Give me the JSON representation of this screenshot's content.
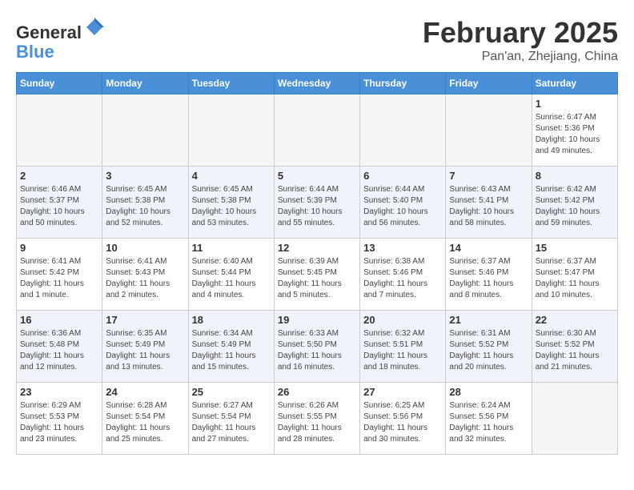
{
  "header": {
    "logo_general": "General",
    "logo_blue": "Blue",
    "month_title": "February 2025",
    "location": "Pan'an, Zhejiang, China"
  },
  "days_of_week": [
    "Sunday",
    "Monday",
    "Tuesday",
    "Wednesday",
    "Thursday",
    "Friday",
    "Saturday"
  ],
  "weeks": [
    [
      {
        "day": "",
        "info": ""
      },
      {
        "day": "",
        "info": ""
      },
      {
        "day": "",
        "info": ""
      },
      {
        "day": "",
        "info": ""
      },
      {
        "day": "",
        "info": ""
      },
      {
        "day": "",
        "info": ""
      },
      {
        "day": "1",
        "info": "Sunrise: 6:47 AM\nSunset: 5:36 PM\nDaylight: 10 hours\nand 49 minutes."
      }
    ],
    [
      {
        "day": "2",
        "info": "Sunrise: 6:46 AM\nSunset: 5:37 PM\nDaylight: 10 hours\nand 50 minutes."
      },
      {
        "day": "3",
        "info": "Sunrise: 6:45 AM\nSunset: 5:38 PM\nDaylight: 10 hours\nand 52 minutes."
      },
      {
        "day": "4",
        "info": "Sunrise: 6:45 AM\nSunset: 5:38 PM\nDaylight: 10 hours\nand 53 minutes."
      },
      {
        "day": "5",
        "info": "Sunrise: 6:44 AM\nSunset: 5:39 PM\nDaylight: 10 hours\nand 55 minutes."
      },
      {
        "day": "6",
        "info": "Sunrise: 6:44 AM\nSunset: 5:40 PM\nDaylight: 10 hours\nand 56 minutes."
      },
      {
        "day": "7",
        "info": "Sunrise: 6:43 AM\nSunset: 5:41 PM\nDaylight: 10 hours\nand 58 minutes."
      },
      {
        "day": "8",
        "info": "Sunrise: 6:42 AM\nSunset: 5:42 PM\nDaylight: 10 hours\nand 59 minutes."
      }
    ],
    [
      {
        "day": "9",
        "info": "Sunrise: 6:41 AM\nSunset: 5:42 PM\nDaylight: 11 hours\nand 1 minute."
      },
      {
        "day": "10",
        "info": "Sunrise: 6:41 AM\nSunset: 5:43 PM\nDaylight: 11 hours\nand 2 minutes."
      },
      {
        "day": "11",
        "info": "Sunrise: 6:40 AM\nSunset: 5:44 PM\nDaylight: 11 hours\nand 4 minutes."
      },
      {
        "day": "12",
        "info": "Sunrise: 6:39 AM\nSunset: 5:45 PM\nDaylight: 11 hours\nand 5 minutes."
      },
      {
        "day": "13",
        "info": "Sunrise: 6:38 AM\nSunset: 5:46 PM\nDaylight: 11 hours\nand 7 minutes."
      },
      {
        "day": "14",
        "info": "Sunrise: 6:37 AM\nSunset: 5:46 PM\nDaylight: 11 hours\nand 8 minutes."
      },
      {
        "day": "15",
        "info": "Sunrise: 6:37 AM\nSunset: 5:47 PM\nDaylight: 11 hours\nand 10 minutes."
      }
    ],
    [
      {
        "day": "16",
        "info": "Sunrise: 6:36 AM\nSunset: 5:48 PM\nDaylight: 11 hours\nand 12 minutes."
      },
      {
        "day": "17",
        "info": "Sunrise: 6:35 AM\nSunset: 5:49 PM\nDaylight: 11 hours\nand 13 minutes."
      },
      {
        "day": "18",
        "info": "Sunrise: 6:34 AM\nSunset: 5:49 PM\nDaylight: 11 hours\nand 15 minutes."
      },
      {
        "day": "19",
        "info": "Sunrise: 6:33 AM\nSunset: 5:50 PM\nDaylight: 11 hours\nand 16 minutes."
      },
      {
        "day": "20",
        "info": "Sunrise: 6:32 AM\nSunset: 5:51 PM\nDaylight: 11 hours\nand 18 minutes."
      },
      {
        "day": "21",
        "info": "Sunrise: 6:31 AM\nSunset: 5:52 PM\nDaylight: 11 hours\nand 20 minutes."
      },
      {
        "day": "22",
        "info": "Sunrise: 6:30 AM\nSunset: 5:52 PM\nDaylight: 11 hours\nand 21 minutes."
      }
    ],
    [
      {
        "day": "23",
        "info": "Sunrise: 6:29 AM\nSunset: 5:53 PM\nDaylight: 11 hours\nand 23 minutes."
      },
      {
        "day": "24",
        "info": "Sunrise: 6:28 AM\nSunset: 5:54 PM\nDaylight: 11 hours\nand 25 minutes."
      },
      {
        "day": "25",
        "info": "Sunrise: 6:27 AM\nSunset: 5:54 PM\nDaylight: 11 hours\nand 27 minutes."
      },
      {
        "day": "26",
        "info": "Sunrise: 6:26 AM\nSunset: 5:55 PM\nDaylight: 11 hours\nand 28 minutes."
      },
      {
        "day": "27",
        "info": "Sunrise: 6:25 AM\nSunset: 5:56 PM\nDaylight: 11 hours\nand 30 minutes."
      },
      {
        "day": "28",
        "info": "Sunrise: 6:24 AM\nSunset: 5:56 PM\nDaylight: 11 hours\nand 32 minutes."
      },
      {
        "day": "",
        "info": ""
      }
    ]
  ]
}
